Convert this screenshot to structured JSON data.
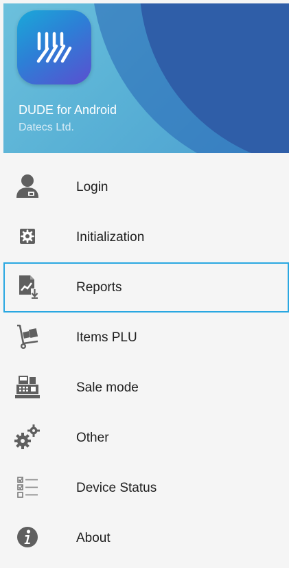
{
  "header": {
    "app_name": "DUDE for Android",
    "company": "Datecs Ltd."
  },
  "menu": {
    "items": [
      {
        "label": "Login",
        "icon": "user-icon"
      },
      {
        "label": "Initialization",
        "icon": "settings-gear-icon"
      },
      {
        "label": "Reports",
        "icon": "report-download-icon",
        "selected": true
      },
      {
        "label": "Items PLU",
        "icon": "hand-truck-icon"
      },
      {
        "label": "Sale mode",
        "icon": "cash-register-icon"
      },
      {
        "label": "Other",
        "icon": "gears-icon"
      },
      {
        "label": "Device Status",
        "icon": "checklist-icon"
      },
      {
        "label": "About",
        "icon": "info-icon"
      }
    ]
  },
  "colors": {
    "selection_border": "#29a7e1",
    "header_light": "#5ab2d6",
    "header_dark": "#2f5ea8",
    "icon_gray": "#5f5f5f"
  }
}
